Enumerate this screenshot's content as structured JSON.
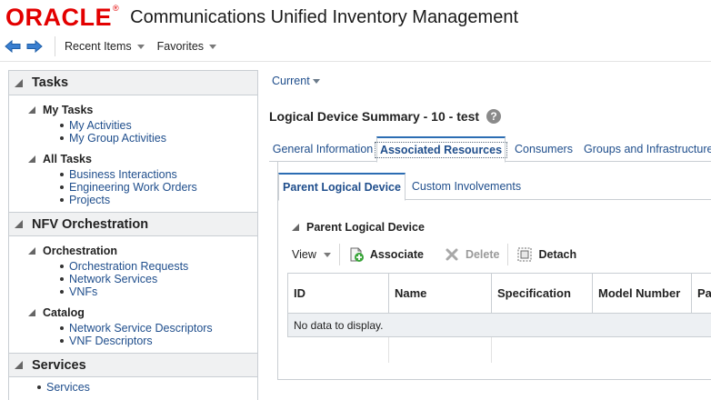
{
  "header": {
    "logo": "ORACLE",
    "logo_mark": "®",
    "app_title": "Communications Unified Inventory Management"
  },
  "toolbar": {
    "recent_items": "Recent Items",
    "favorites": "Favorites"
  },
  "tasks": {
    "title": "Tasks",
    "my_tasks": {
      "title": "My Tasks",
      "items": [
        "My Activities",
        "My Group Activities"
      ]
    },
    "all_tasks": {
      "title": "All Tasks",
      "items": [
        "Business Interactions",
        "Engineering Work Orders",
        "Projects"
      ]
    }
  },
  "nfv": {
    "title": "NFV Orchestration",
    "orchestration": {
      "title": "Orchestration",
      "items": [
        "Orchestration Requests",
        "Network Services",
        "VNFs"
      ]
    },
    "catalog": {
      "title": "Catalog",
      "items": [
        "Network Service Descriptors",
        "VNF Descriptors"
      ]
    }
  },
  "services": {
    "title": "Services",
    "items": [
      "Services"
    ]
  },
  "main": {
    "current": "Current",
    "page_title": "Logical Device Summary - 10 - test",
    "help_glyph": "?",
    "tabs": [
      "General Information",
      "Associated Resources",
      "Consumers",
      "Groups and Infrastructure"
    ],
    "active_tab": "Associated Resources",
    "subtabs": [
      "Parent Logical Device",
      "Custom Involvements"
    ],
    "section_title": "Parent Logical Device",
    "table_toolbar": {
      "view": "View",
      "associate": "Associate",
      "delete": "Delete",
      "detach": "Detach"
    },
    "table": {
      "columns": [
        "ID",
        "Name",
        "Specification",
        "Model Number",
        "Pa"
      ],
      "empty_text": "No data to display."
    }
  },
  "colors": {
    "brand_red": "#e30000",
    "link_blue": "#1f4e8c",
    "accent_blue": "#2c6db3",
    "border": "#c9ced3"
  }
}
